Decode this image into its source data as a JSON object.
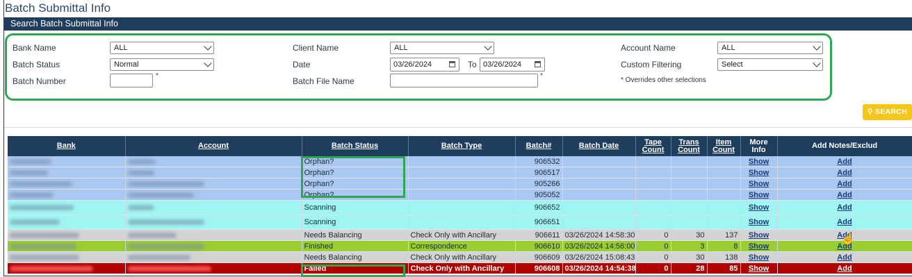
{
  "page": {
    "title": "Batch Submittal Info",
    "section_title": "Search Batch Submittal Info"
  },
  "filters": {
    "bank_name": {
      "label": "Bank Name",
      "value": "ALL"
    },
    "batch_status": {
      "label": "Batch Status",
      "value": "Normal"
    },
    "batch_number": {
      "label": "Batch Number",
      "value": "",
      "required_mark": "*"
    },
    "client_name": {
      "label": "Client Name",
      "value": "ALL"
    },
    "date": {
      "label": "Date",
      "from": "03/26/2024",
      "to_label": "To",
      "to": "03/26/2024"
    },
    "batch_file_name": {
      "label": "Batch File Name",
      "value": "",
      "required_mark": "*"
    },
    "account_name": {
      "label": "Account Name",
      "value": "ALL"
    },
    "custom_filtering": {
      "label": "Custom Filtering",
      "value": "Select"
    },
    "overrides_note": "* Overrides other selections"
  },
  "search_button": {
    "label": "SEARCH",
    "icon": "search-icon"
  },
  "table": {
    "headers": [
      "Bank",
      "Account",
      "Batch Status",
      "Batch Type",
      "Batch#",
      "Batch Date",
      "Tape Count",
      "Trans Count",
      "Item Count",
      "More Info",
      "Add Notes/Exclud"
    ],
    "rows": [
      {
        "status": "Orphan?",
        "type": "",
        "batch": "906532",
        "date": "",
        "tape": "",
        "trans": "",
        "item": "",
        "more": "Show",
        "add": "Add",
        "color": "#a9c7f0"
      },
      {
        "status": "Orphan?",
        "type": "",
        "batch": "906517",
        "date": "",
        "tape": "",
        "trans": "",
        "item": "",
        "more": "Show",
        "add": "Add",
        "color": "#a9c7f0"
      },
      {
        "status": "Orphan?",
        "type": "",
        "batch": "905266",
        "date": "",
        "tape": "",
        "trans": "",
        "item": "",
        "more": "Show",
        "add": "Add",
        "color": "#a9c7f0"
      },
      {
        "status": "Orphan?",
        "type": "",
        "batch": "905052",
        "date": "",
        "tape": "",
        "trans": "",
        "item": "",
        "more": "Show",
        "add": "Add",
        "color": "#a9c7f0"
      },
      {
        "status": "Scanning",
        "type": "",
        "batch": "906652",
        "date": "",
        "tape": "",
        "trans": "",
        "item": "",
        "more": "Show",
        "add": "Add",
        "color": "#9ff5f1"
      },
      {
        "status": "Scanning",
        "type": "",
        "batch": "906651",
        "date": "",
        "tape": "",
        "trans": "",
        "item": "",
        "more": "Show",
        "add": "Add",
        "color": "#9ff5f1"
      },
      {
        "status": "Needs Balancing",
        "type": "Check Only with Ancillary",
        "batch": "906611",
        "date": "03/26/2024 14:58:30",
        "tape": "0",
        "trans": "30",
        "item": "137",
        "more": "Show",
        "add": "Add",
        "color": "#d3d3d3"
      },
      {
        "status": "Finished",
        "type": "Correspondence",
        "batch": "906610",
        "date": "03/26/2024 14:56:00",
        "tape": "0",
        "trans": "3",
        "item": "8",
        "more": "Show",
        "add": "Add",
        "color": "#9acd32"
      },
      {
        "status": "Needs Balancing",
        "type": "Check Only with Ancillary",
        "batch": "906609",
        "date": "03/26/2024 15:08:43",
        "tape": "0",
        "trans": "30",
        "item": "138",
        "more": "Show",
        "add": "Add",
        "color": "#d3d3d3"
      },
      {
        "status": "Failed",
        "type": "Check Only with Ancillary",
        "batch": "906608",
        "date": "03/26/2024 14:54:38",
        "tape": "0",
        "trans": "28",
        "item": "85",
        "more": "Show",
        "add": "Add",
        "color": "#b00000"
      }
    ]
  },
  "colors": {
    "header": "#1f3d5c",
    "highlight": "#2ea84f",
    "search": "#f5c518"
  }
}
